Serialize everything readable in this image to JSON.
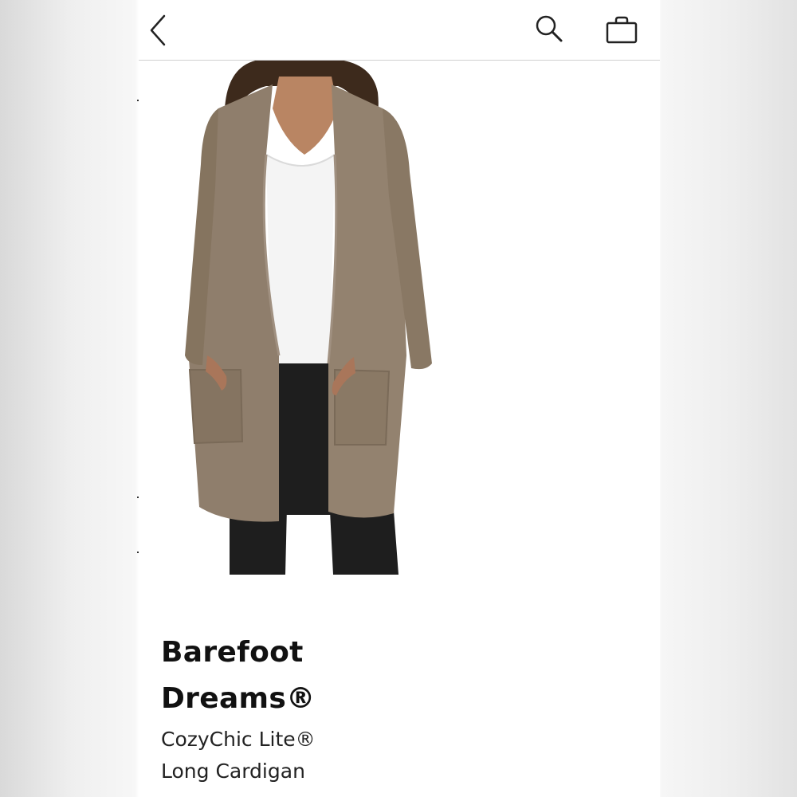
{
  "nav": {
    "back_icon": "chevron-left-icon",
    "search_icon": "search-icon",
    "bag_icon": "shopping-bag-icon"
  },
  "product": {
    "image_icon": "cardigan-photo",
    "brand_line1": "Barefoot",
    "brand_line2": "Dreams®",
    "name_line1": "CozyChic Lite®",
    "name_line2": "Long Cardigan"
  },
  "colors": {
    "cardigan": "#8f7e6c",
    "text": "#111111",
    "divider": "#cfcfcf"
  }
}
